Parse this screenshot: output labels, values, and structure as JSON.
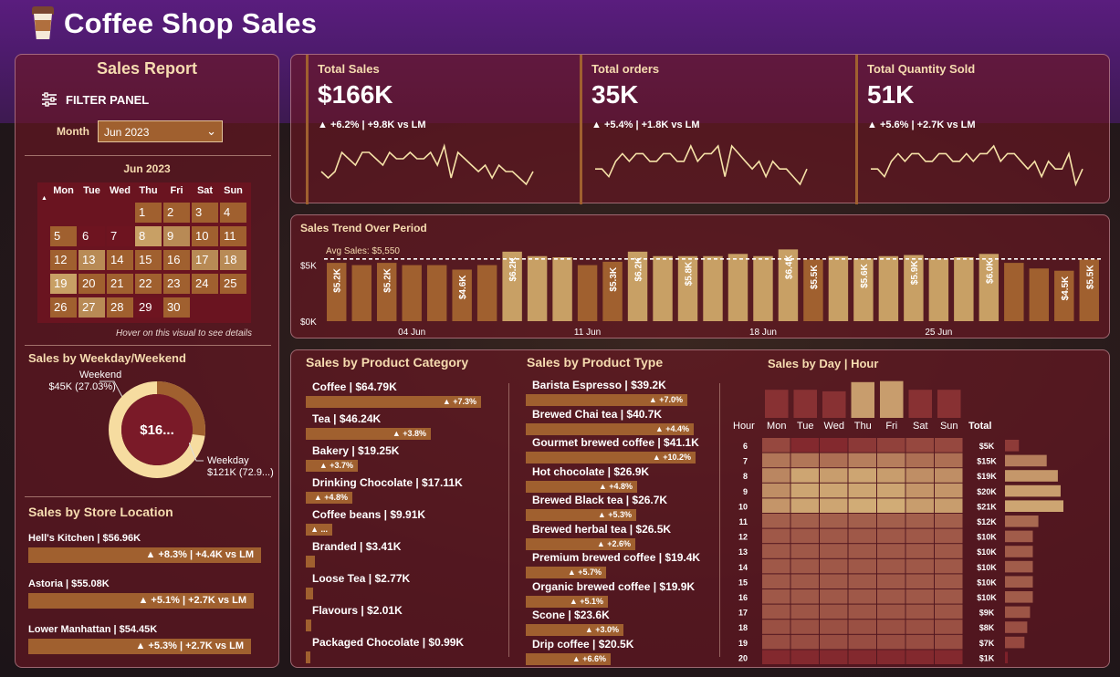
{
  "header": {
    "title": "Coffee Shop Sales"
  },
  "left": {
    "title": "Sales Report",
    "filter_label": "FILTER PANEL",
    "month_label": "Month",
    "month_value": "Jun 2023",
    "calendar": {
      "title": "Jun 2023",
      "weekdays": [
        "Mon",
        "Tue",
        "Wed",
        "Thu",
        "Fri",
        "Sat",
        "Sun"
      ],
      "days": [
        {
          "d": "1",
          "shade": 1
        },
        {
          "d": "2",
          "shade": 1
        },
        {
          "d": "3",
          "shade": 1
        },
        {
          "d": "4",
          "shade": 1
        },
        {
          "d": "5",
          "shade": 1
        },
        {
          "d": "6",
          "shade": 0
        },
        {
          "d": "7",
          "shade": 0
        },
        {
          "d": "8",
          "shade": 3
        },
        {
          "d": "9",
          "shade": 2
        },
        {
          "d": "10",
          "shade": 1
        },
        {
          "d": "11",
          "shade": 1
        },
        {
          "d": "12",
          "shade": 1
        },
        {
          "d": "13",
          "shade": 2
        },
        {
          "d": "14",
          "shade": 1
        },
        {
          "d": "15",
          "shade": 1
        },
        {
          "d": "16",
          "shade": 1
        },
        {
          "d": "17",
          "shade": 2
        },
        {
          "d": "18",
          "shade": 2
        },
        {
          "d": "19",
          "shade": 3
        },
        {
          "d": "20",
          "shade": 1
        },
        {
          "d": "21",
          "shade": 1
        },
        {
          "d": "22",
          "shade": 1
        },
        {
          "d": "23",
          "shade": 1
        },
        {
          "d": "24",
          "shade": 1
        },
        {
          "d": "25",
          "shade": 1
        },
        {
          "d": "26",
          "shade": 1
        },
        {
          "d": "27",
          "shade": 2
        },
        {
          "d": "28",
          "shade": 1
        },
        {
          "d": "29",
          "shade": 0
        },
        {
          "d": "30",
          "shade": 1
        }
      ],
      "hover_note": "Hover on this visual to see details"
    },
    "weekday_title": "Sales by Weekday/Weekend",
    "donut": {
      "center": "$16...",
      "weekend_name": "Weekend",
      "weekend_value": "$45K (27.03%)",
      "weekday_name": "Weekday",
      "weekday_value": "$121K (72.9...)",
      "weekend_share": 27.03
    },
    "store_title": "Sales by Store Location",
    "stores": [
      {
        "label": "Hell's Kitchen | $56.96K",
        "delta": "▲ +8.3% | +4.4K vs LM",
        "share": 1.0
      },
      {
        "label": "Astoria | $55.08K",
        "delta": "▲ +5.1% | +2.7K vs LM",
        "share": 0.967
      },
      {
        "label": "Lower Manhattan | $54.45K",
        "delta": "▲ +5.3% | +2.7K vs LM",
        "share": 0.956
      }
    ]
  },
  "kpis": [
    {
      "title": "Total Sales",
      "value": "$166K",
      "delta": "▲ +6.2% | +9.8K vs LM",
      "spark": [
        3,
        2,
        3,
        6,
        5,
        4,
        6,
        6,
        5,
        4,
        6,
        5,
        5,
        6,
        5,
        5,
        6,
        4,
        7,
        2,
        6,
        5,
        4,
        3,
        4,
        2,
        4,
        3,
        3,
        2,
        1,
        3
      ]
    },
    {
      "title": "Total orders",
      "value": "35K",
      "delta": "▲ +5.4% | +1.8K vs LM",
      "spark": [
        3,
        3,
        2,
        4,
        5,
        4,
        5,
        5,
        4,
        4,
        5,
        5,
        4,
        4,
        6,
        4,
        5,
        5,
        6,
        2,
        6,
        5,
        4,
        3,
        4,
        2,
        4,
        3,
        3,
        2,
        1,
        3
      ]
    },
    {
      "title": "Total Quantity Sold",
      "value": "51K",
      "delta": "▲ +5.6% | +2.7K vs LM",
      "spark": [
        3,
        3,
        2,
        4,
        5,
        4,
        5,
        5,
        4,
        4,
        5,
        5,
        4,
        4,
        5,
        4,
        5,
        5,
        6,
        4,
        5,
        5,
        4,
        3,
        4,
        2,
        4,
        3,
        3,
        5,
        1,
        3
      ]
    }
  ],
  "trend": {
    "title": "Sales Trend Over Period",
    "avg_label": "Avg Sales: $5,550",
    "avg": 5550,
    "ymax": 7000,
    "y_ticks": [
      {
        "v": 0,
        "label": "$0K"
      },
      {
        "v": 5000,
        "label": "$5K"
      }
    ],
    "x_ticks": [
      {
        "i": 3,
        "label": "04 Jun"
      },
      {
        "i": 10,
        "label": "11 Jun"
      },
      {
        "i": 17,
        "label": "18 Jun"
      },
      {
        "i": 24,
        "label": "25 Jun"
      }
    ],
    "values": [
      5200,
      5000,
      5200,
      5000,
      5000,
      4600,
      5000,
      6200,
      5800,
      5700,
      5000,
      5300,
      6200,
      5800,
      5800,
      5800,
      6000,
      5800,
      6400,
      5500,
      5800,
      5600,
      5800,
      5900,
      5600,
      5700,
      6000,
      5200,
      4700,
      4500,
      5500
    ],
    "labels": [
      "$5.2K",
      "",
      "$5.2K",
      "",
      "",
      "$4.6K",
      "",
      "$6.2K",
      "",
      "",
      "",
      "$5.3K",
      "$6.2K",
      "",
      "$5.8K",
      "",
      "",
      "",
      "$6.4K",
      "$5.5K",
      "",
      "$5.6K",
      "",
      "$5.9K",
      "",
      "",
      "$6.0K",
      "",
      "",
      "$4.5K",
      "$5.5K"
    ]
  },
  "categories": {
    "title": "Sales by Product Category",
    "items": [
      {
        "label": "Coffee | $64.79K",
        "delta": "▲ +7.3%",
        "value": 64.79
      },
      {
        "label": "Tea | $46.24K",
        "delta": "▲ +3.8%",
        "value": 46.24
      },
      {
        "label": "Bakery | $19.25K",
        "delta": "▲ +3.7%",
        "value": 19.25
      },
      {
        "label": "Drinking Chocolate | $17.11K",
        "delta": "▲ +4.8%",
        "value": 17.11
      },
      {
        "label": "Coffee beans | $9.91K",
        "delta": "▲ ...",
        "value": 9.91
      },
      {
        "label": "Branded | $3.41K",
        "delta": "",
        "value": 3.41
      },
      {
        "label": "Loose Tea | $2.77K",
        "delta": "",
        "value": 2.77
      },
      {
        "label": "Flavours | $2.01K",
        "delta": "",
        "value": 2.01
      },
      {
        "label": "Packaged Chocolate | $0.99K",
        "delta": "",
        "value": 0.99
      }
    ]
  },
  "types": {
    "title": "Sales by Product Type",
    "items": [
      {
        "label": "Barista Espresso | $39.2K",
        "delta": "▲ +7.0%",
        "value": 39.2
      },
      {
        "label": "Brewed Chai tea | $40.7K",
        "delta": "▲ +4.4%",
        "value": 40.7
      },
      {
        "label": "Gourmet brewed coffee | $41.1K",
        "delta": "▲ +10.2%",
        "value": 41.1
      },
      {
        "label": "Hot chocolate | $26.9K",
        "delta": "▲ +4.8%",
        "value": 26.9
      },
      {
        "label": "Brewed Black tea | $26.7K",
        "delta": "▲ +5.3%",
        "value": 26.7
      },
      {
        "label": "Brewed herbal tea | $26.5K",
        "delta": "▲ +2.6%",
        "value": 26.5
      },
      {
        "label": "Premium brewed coffee | $19.4K",
        "delta": "▲ +5.7%",
        "value": 19.4
      },
      {
        "label": "Organic brewed coffee | $19.9K",
        "delta": "▲ +5.1%",
        "value": 19.9
      },
      {
        "label": "Scone | $23.6K",
        "delta": "▲ +3.0%",
        "value": 23.6
      },
      {
        "label": "Drip coffee | $20.5K",
        "delta": "▲ +6.6%",
        "value": 20.5
      }
    ]
  },
  "heatmap": {
    "title": "Sales by Day | Hour",
    "hour_label": "Hour",
    "total_label": "Total",
    "days": [
      "Mon",
      "Tue",
      "Wed",
      "Thu",
      "Fri",
      "Sat",
      "Sun"
    ],
    "day_totals": [
      0.55,
      0.55,
      0.52,
      0.7,
      0.72,
      0.55,
      0.55
    ],
    "hours": [
      "6",
      "7",
      "8",
      "9",
      "10",
      "11",
      "12",
      "13",
      "14",
      "15",
      "16",
      "17",
      "18",
      "19",
      "20"
    ],
    "totals": [
      "$5K",
      "$15K",
      "$19K",
      "$20K",
      "$21K",
      "$12K",
      "$10K",
      "$10K",
      "$10K",
      "$10K",
      "$10K",
      "$9K",
      "$8K",
      "$7K",
      "$1K"
    ],
    "total_values": [
      5,
      15,
      19,
      20,
      21,
      12,
      10,
      10,
      10,
      10,
      10,
      9,
      8,
      7,
      1
    ],
    "cells": [
      [
        0.3,
        0.1,
        0.1,
        0.2,
        0.25,
        0.3,
        0.3
      ],
      [
        0.6,
        0.6,
        0.55,
        0.65,
        0.65,
        0.55,
        0.55
      ],
      [
        0.7,
        0.9,
        0.85,
        0.9,
        0.85,
        0.75,
        0.75
      ],
      [
        0.75,
        0.9,
        0.9,
        0.9,
        0.9,
        0.8,
        0.8
      ],
      [
        0.8,
        0.9,
        0.9,
        0.95,
        0.95,
        0.85,
        0.85
      ],
      [
        0.45,
        0.45,
        0.45,
        0.45,
        0.45,
        0.45,
        0.45
      ],
      [
        0.4,
        0.4,
        0.4,
        0.4,
        0.4,
        0.4,
        0.4
      ],
      [
        0.4,
        0.4,
        0.4,
        0.4,
        0.4,
        0.4,
        0.4
      ],
      [
        0.4,
        0.4,
        0.4,
        0.4,
        0.4,
        0.4,
        0.4
      ],
      [
        0.4,
        0.4,
        0.4,
        0.4,
        0.4,
        0.4,
        0.4
      ],
      [
        0.4,
        0.4,
        0.4,
        0.4,
        0.4,
        0.4,
        0.4
      ],
      [
        0.38,
        0.38,
        0.38,
        0.38,
        0.38,
        0.38,
        0.38
      ],
      [
        0.35,
        0.35,
        0.35,
        0.35,
        0.35,
        0.35,
        0.35
      ],
      [
        0.33,
        0.33,
        0.33,
        0.33,
        0.33,
        0.33,
        0.33
      ],
      [
        0.1,
        0.1,
        0.1,
        0.1,
        0.1,
        0.1,
        0.1
      ]
    ]
  },
  "colors": {
    "accent": "#a0602f",
    "light": "#c8a065",
    "dark": "#7a1a26",
    "text_gold": "#f6dcb0",
    "spark": "#f6e2a8"
  }
}
